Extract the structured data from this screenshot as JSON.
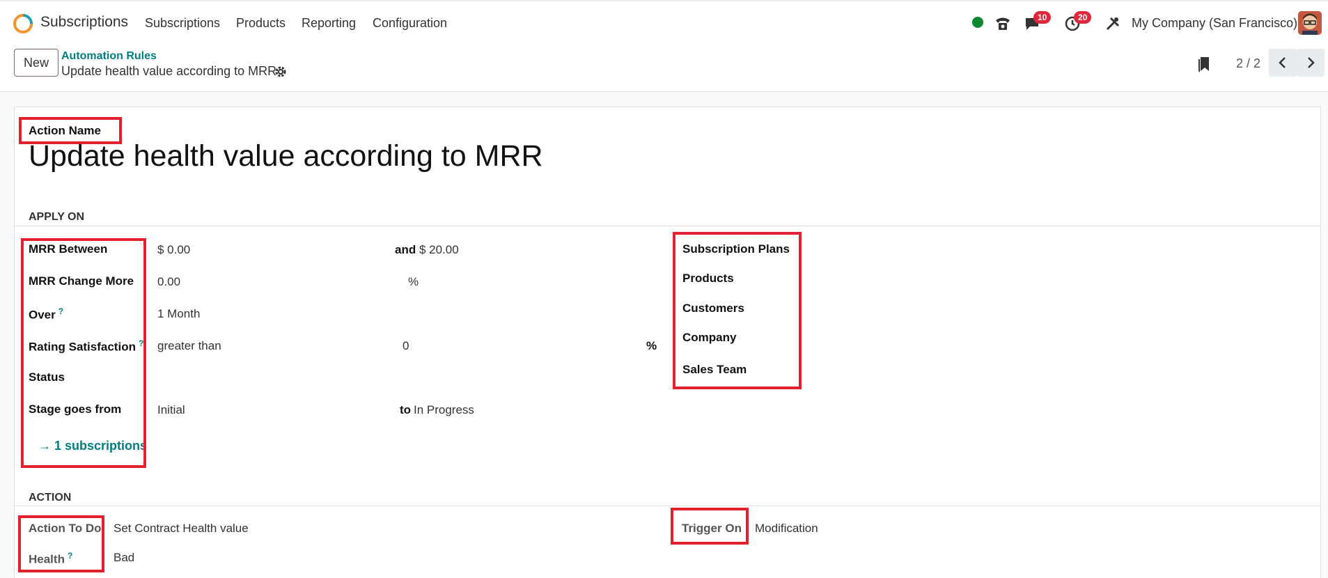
{
  "navbar": {
    "app_name": "Subscriptions",
    "menu": [
      "Subscriptions",
      "Products",
      "Reporting",
      "Configuration"
    ],
    "messages_count": "10",
    "activities_count": "20",
    "company": "My Company (San Francisco)"
  },
  "control_panel": {
    "new_label": "New",
    "breadcrumb_parent": "Automation Rules",
    "breadcrumb_current": "Update health value according to MRR",
    "pager": "2 / 2"
  },
  "form": {
    "action_name_label": "Action Name",
    "action_name_value": "Update health value according to MRR",
    "apply_on_section": "APPLY ON",
    "mrr_between_label": "MRR Between",
    "mrr_between_from": "$ 0.00",
    "and_label": "and",
    "mrr_between_to": "$ 20.00",
    "mrr_change_label": "MRR Change More",
    "mrr_change_value": "0.00",
    "mrr_change_unit": "%",
    "over_label": "Over",
    "over_value": "1 Month",
    "rating_label": "Rating Satisfaction",
    "rating_operator": "greater than",
    "rating_value": "0",
    "rating_unit": "%",
    "status_label": "Status",
    "stage_label": "Stage goes from",
    "stage_from": "Initial",
    "to_label": "to",
    "stage_to": "In Progress",
    "smart_button": "→ 1 subscriptions",
    "right_labels": [
      "Subscription Plans",
      "Products",
      "Customers",
      "Company",
      "Sales Team"
    ],
    "action_section": "ACTION",
    "action_to_do_label": "Action To Do",
    "action_to_do_value": "Set Contract Health value",
    "health_label": "Health",
    "health_value": "Bad",
    "trigger_on_label": "Trigger On",
    "trigger_on_value": "Modification",
    "help_mark": "?"
  },
  "colors": {
    "accent": "#017e84",
    "highlight": "#e2202f",
    "badge": "#e0263b",
    "status_online": "#0a8a2f"
  }
}
